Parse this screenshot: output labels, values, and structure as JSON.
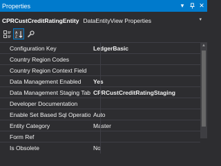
{
  "window": {
    "title": "Properties",
    "pin_glyph": "📌",
    "close_glyph": "✕",
    "dropdown_glyph": "▾"
  },
  "object_selector": {
    "name": "CPRCustCreditRatingEntity",
    "type": "DataEntityView Properties"
  },
  "toolbar": {
    "categorized_icon": "categorized-icon",
    "alphabetical_icon": "alphabetical-icon",
    "property_pages_icon": "wrench-icon"
  },
  "properties": [
    {
      "name": "Configuration Key",
      "value": "LedgerBasic",
      "bold": true
    },
    {
      "name": "Country Region Codes",
      "value": "",
      "bold": false
    },
    {
      "name": "Country Region Context Field",
      "value": "",
      "bold": false
    },
    {
      "name": "Data Management Enabled",
      "value": "Yes",
      "bold": true
    },
    {
      "name": "Data Management Staging Table",
      "value": "CPRCustCreditRatingStaging",
      "bold": true
    },
    {
      "name": "Developer Documentation",
      "value": "",
      "bold": false
    },
    {
      "name": "Enable Set Based Sql Operations",
      "value": "Auto",
      "bold": false
    },
    {
      "name": "Entity Category",
      "value": "Master",
      "bold": false
    },
    {
      "name": "Form Ref",
      "value": "",
      "bold": false
    },
    {
      "name": "Is Obsolete",
      "value": "No",
      "bold": false
    }
  ],
  "colors": {
    "accent": "#007acc",
    "background": "#2d2d30",
    "grid_line": "#3f3f46"
  }
}
